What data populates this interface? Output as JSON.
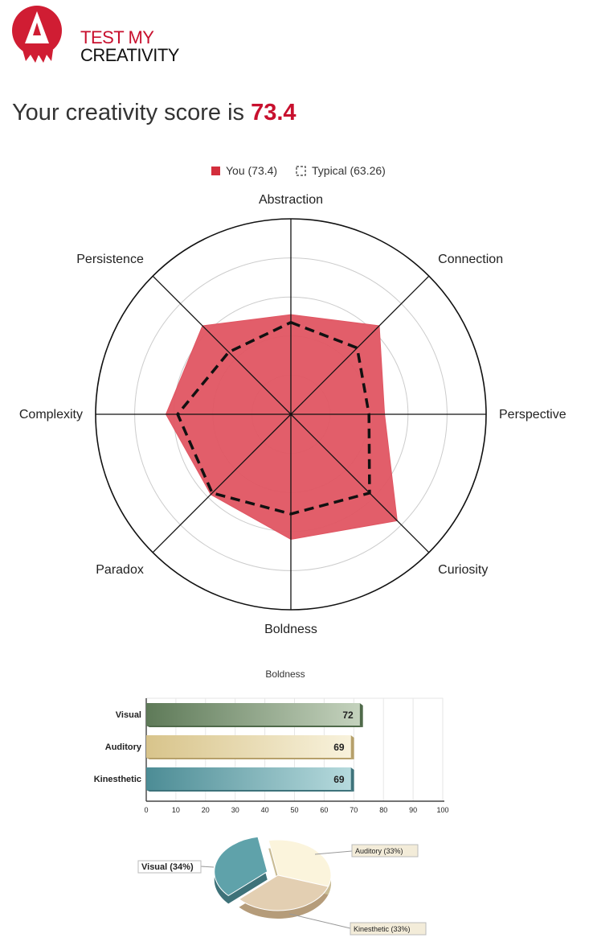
{
  "header": {
    "logo_line1": "TEST MY",
    "logo_line2": "CREATIVITY",
    "score_prefix": "Your creativity score is",
    "score_value": "73.4"
  },
  "colors": {
    "brand_red": "#c8102e",
    "radar_fill": "#e05562",
    "visual": "#6f8a6a",
    "auditory": "#e8d7a3",
    "kinesthetic": "#5f9ea6",
    "pie_kinesthetic": "#dcc6a6"
  },
  "chart_data": [
    {
      "type": "radar",
      "axes": [
        "Abstraction",
        "Connection",
        "Perspective",
        "Curiosity",
        "Boldness",
        "Paradox",
        "Complexity",
        "Persistence"
      ],
      "rlim": [
        0,
        100
      ],
      "grid": true,
      "legend_position": "top-center",
      "series": [
        {
          "name": "You (73.4)",
          "values": [
            51,
            64,
            48,
            77,
            64,
            58,
            64,
            64
          ]
        },
        {
          "name": "Typical (63.26)",
          "values": [
            47,
            48,
            40,
            57,
            51,
            57,
            58,
            45
          ]
        }
      ]
    },
    {
      "type": "bar",
      "orientation": "horizontal",
      "title": "Boldness",
      "categories": [
        "Visual",
        "Auditory",
        "Kinesthetic"
      ],
      "values": [
        72,
        69,
        69
      ],
      "xlim": [
        0,
        100
      ],
      "xticks": [
        "0",
        "10",
        "20",
        "30",
        "40",
        "50",
        "60",
        "70",
        "80",
        "90",
        "100"
      ],
      "grid": true
    },
    {
      "type": "pie",
      "categories": [
        "Visual (34%)",
        "Auditory (33%)",
        "Kinesthetic (33%)"
      ],
      "values": [
        34,
        33,
        33
      ]
    }
  ]
}
